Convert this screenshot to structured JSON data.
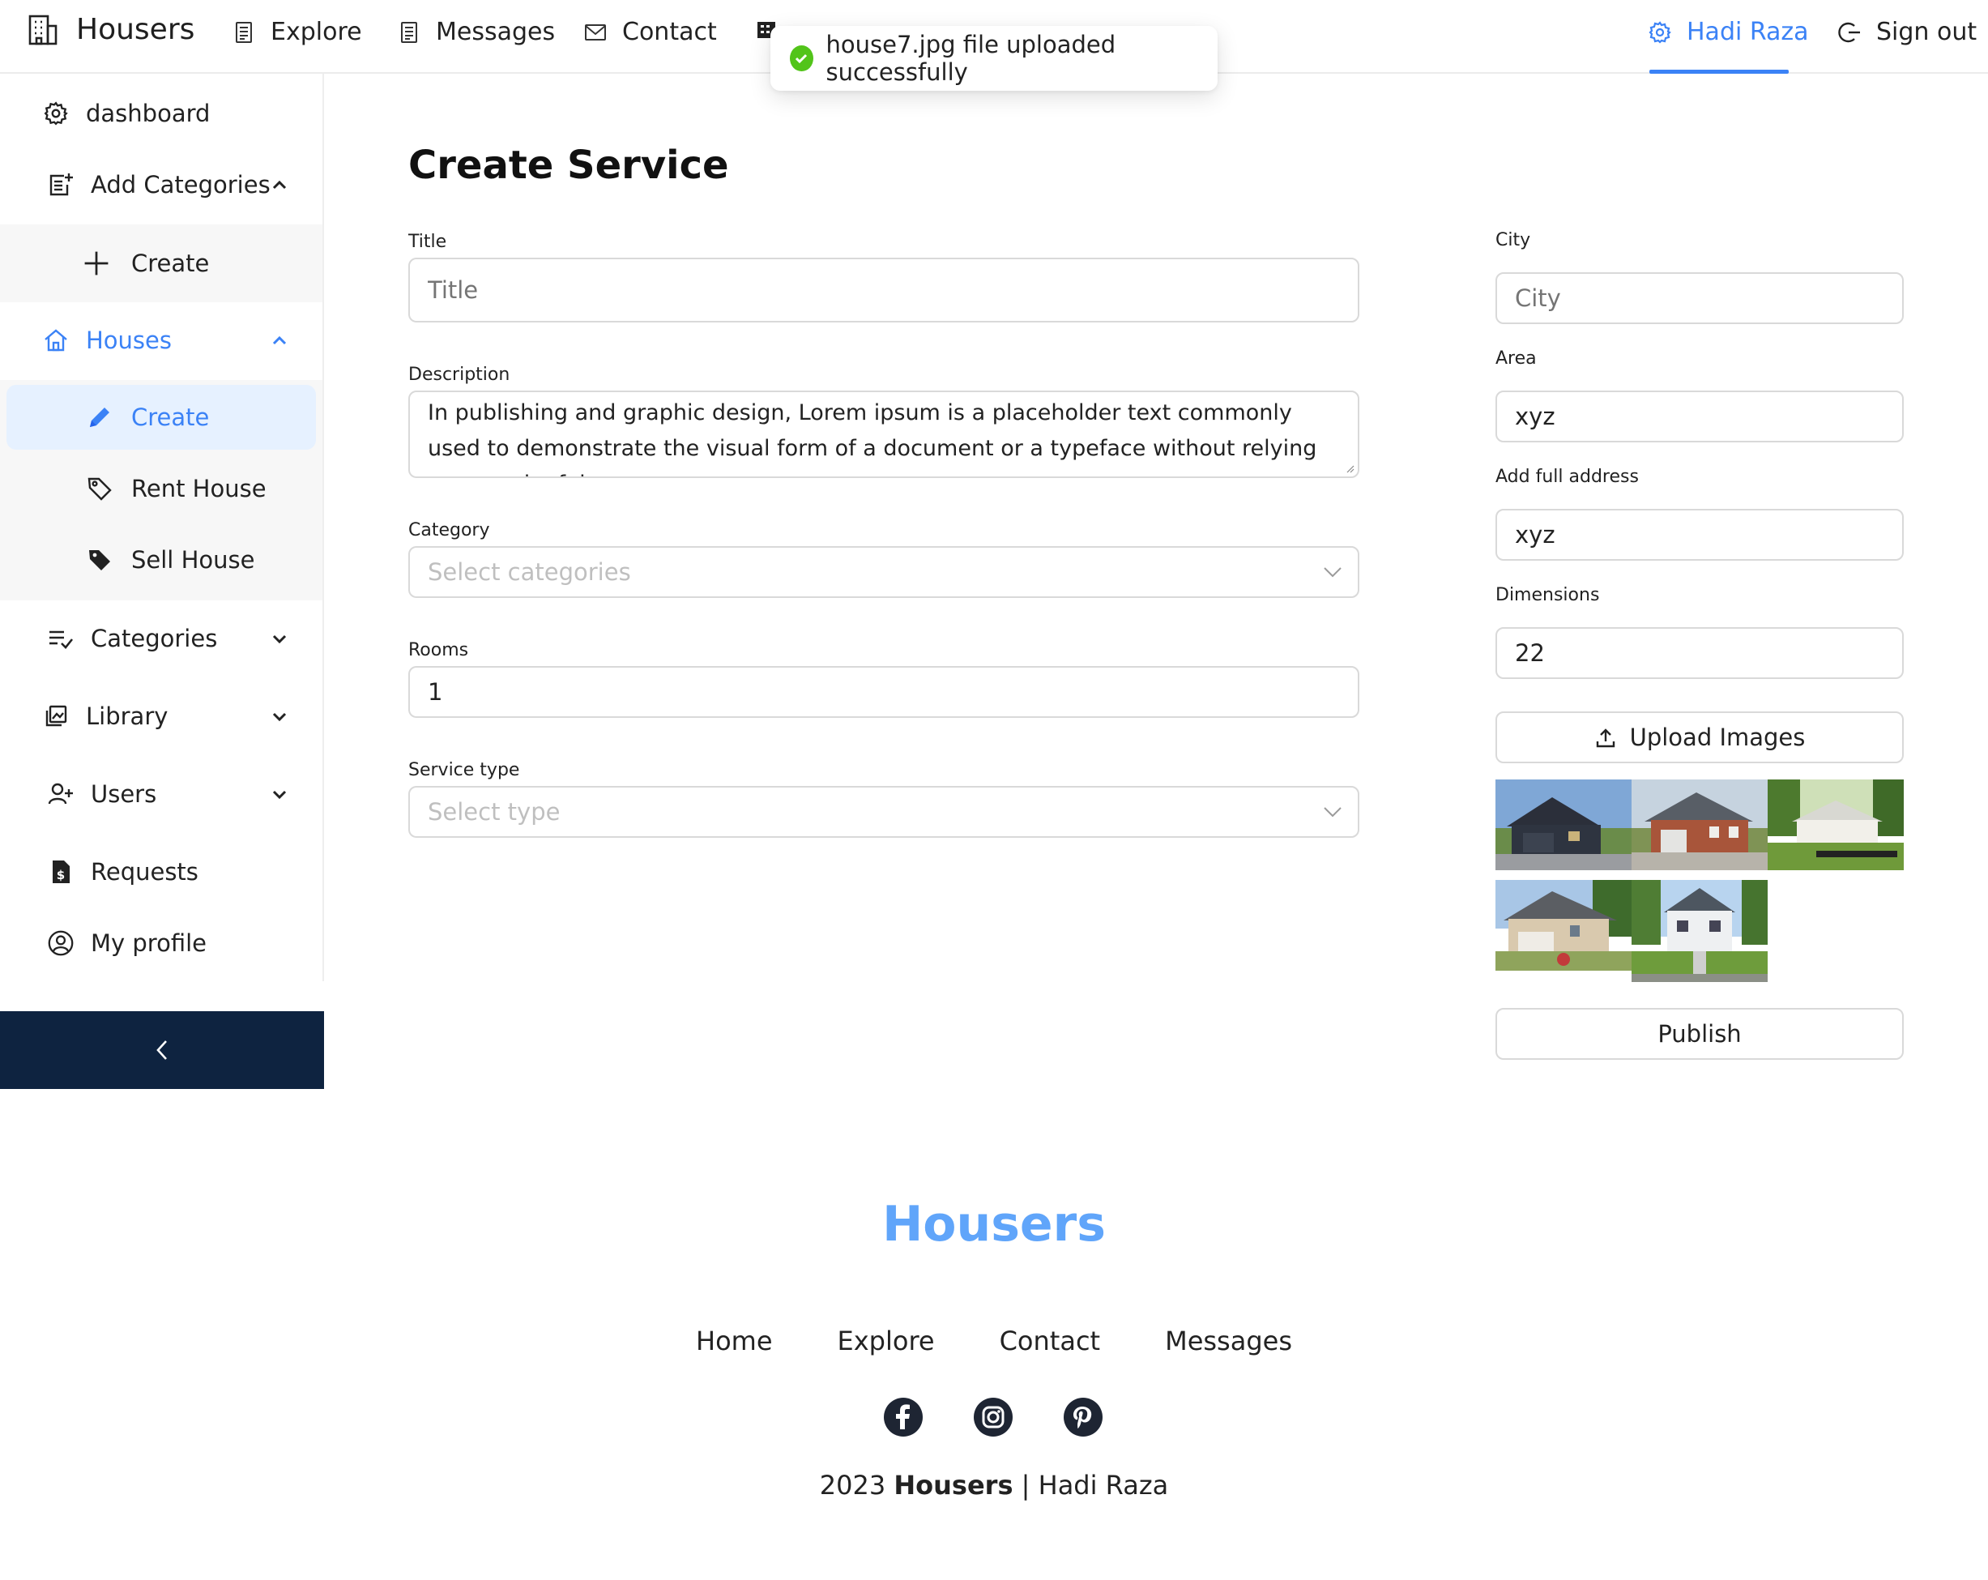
{
  "header": {
    "brand": "Housers",
    "nav": [
      {
        "label": "Explore",
        "icon": "document-icon"
      },
      {
        "label": "Messages",
        "icon": "document-icon"
      },
      {
        "label": "Contact",
        "icon": "mail-icon"
      }
    ],
    "user_name": "Hadi Raza",
    "sign_out": "Sign out"
  },
  "toast": {
    "message": "house7.jpg file uploaded successfully",
    "status_color": "#52c41a"
  },
  "sidebar": {
    "items": [
      {
        "label": "dashboard",
        "icon": "gear-icon"
      },
      {
        "label": "Add Categories",
        "icon": "add-list-icon",
        "expanded": true
      },
      {
        "label": "Create",
        "icon": "plus-icon"
      },
      {
        "label": "Houses",
        "icon": "home-icon",
        "expanded": true
      },
      {
        "label": "Create",
        "icon": "pencil-icon",
        "active": true
      },
      {
        "label": "Rent House",
        "icon": "tag-outline-icon"
      },
      {
        "label": "Sell House",
        "icon": "tag-filled-icon"
      },
      {
        "label": "Categories",
        "icon": "playlist-check-icon",
        "expanded": false
      },
      {
        "label": "Library",
        "icon": "library-icon",
        "expanded": false
      },
      {
        "label": "Users",
        "icon": "user-add-icon",
        "expanded": false
      },
      {
        "label": "Requests",
        "icon": "invoice-icon"
      },
      {
        "label": "My profile",
        "icon": "user-circle-icon"
      }
    ],
    "collapse_icon": "chevron-left-icon",
    "accent": "#3b82f6",
    "collapse_bg": "#0e2340"
  },
  "form": {
    "title": "Create Service",
    "title_field": {
      "label": "Title",
      "placeholder": "Title",
      "value": ""
    },
    "description": {
      "label": "Description",
      "value": "In publishing and graphic design, Lorem ipsum is a placeholder text commonly used to demonstrate the visual form of a document or a typeface without relying on meaningful"
    },
    "category": {
      "label": "Category",
      "placeholder": "Select categories"
    },
    "rooms": {
      "label": "Rooms",
      "value": "1"
    },
    "service_type": {
      "label": "Service type",
      "placeholder": "Select type"
    },
    "city": {
      "label": "City",
      "placeholder": "City",
      "value": ""
    },
    "area": {
      "label": "Area",
      "value": "xyz"
    },
    "address": {
      "label": "Add full address",
      "value": "xyz"
    },
    "dimensions": {
      "label": "Dimensions",
      "value": "22"
    },
    "upload_label": "Upload Images",
    "publish_label": "Publish"
  },
  "footer": {
    "brand": "Housers",
    "links": [
      "Home",
      "Explore",
      "Contact",
      "Messages"
    ],
    "social": [
      "facebook-icon",
      "instagram-icon",
      "pinterest-icon"
    ],
    "copyright_year": "2023",
    "copyright_brand": "Housers",
    "copyright_sep": "|",
    "copyright_name": "Hadi Raza",
    "brand_color": "#60a5fa"
  }
}
